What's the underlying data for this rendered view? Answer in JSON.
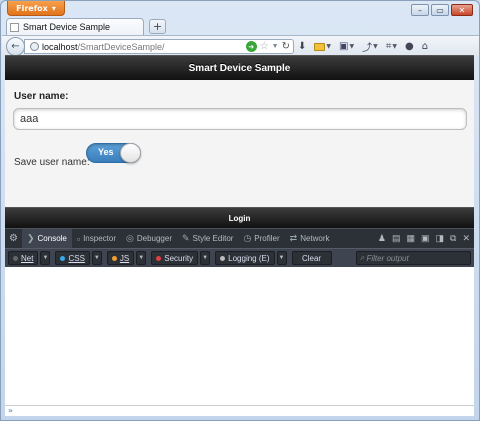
{
  "browser": {
    "app_button": "Firefox",
    "tab_title": "Smart Device Sample",
    "url_host": "localhost",
    "url_path": "/SmartDeviceSample/"
  },
  "page": {
    "header_title": "Smart Device Sample",
    "user_label": "User name:",
    "user_value": "aaa",
    "save_label": "Save user name:",
    "switch_label": "Yes",
    "footer_label": "Login"
  },
  "devtools": {
    "tabs": [
      "Console",
      "Inspector",
      "Debugger",
      "Style Editor",
      "Profiler",
      "Network"
    ],
    "filters": {
      "net": "Net",
      "css": "CSS",
      "js": "JS",
      "security": "Security",
      "logging": "Logging (E)",
      "clear": "Clear",
      "filter_placeholder": "Filter output"
    },
    "colors": {
      "css": "#3ba8e8",
      "js": "#f0a030",
      "security": "#e04040",
      "logging": "#bbbbbb"
    }
  }
}
